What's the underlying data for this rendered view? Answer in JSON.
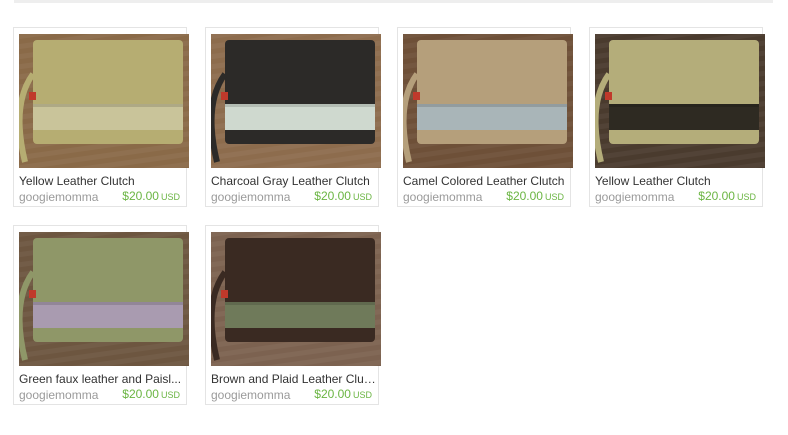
{
  "listings": [
    {
      "title": "Yellow Leather Clutch",
      "shop": "googiemomma",
      "price": "$20.00",
      "currency": "USD",
      "image_icon": "clutch-photo-icon",
      "clutch_color": "#b6ad72",
      "band_color": "#c9c49a",
      "bg_color": "#8a6a48"
    },
    {
      "title": "Charcoal Gray Leather Clutch",
      "shop": "googiemomma",
      "price": "$20.00",
      "currency": "USD",
      "image_icon": "clutch-photo-icon",
      "clutch_color": "#2c2a28",
      "band_color": "#cfd9cf",
      "bg_color": "#8d6c4d"
    },
    {
      "title": "Camel Colored Leather Clutch",
      "shop": "googiemomma",
      "price": "$20.00",
      "currency": "USD",
      "image_icon": "clutch-photo-icon",
      "clutch_color": "#b59f7b",
      "band_color": "#a9b5b8",
      "bg_color": "#6e5038"
    },
    {
      "title": "Yellow Leather Clutch",
      "shop": "googiemomma",
      "price": "$20.00",
      "currency": "USD",
      "image_icon": "clutch-photo-icon",
      "clutch_color": "#b4ad7a",
      "band_color": "#2e2a22",
      "bg_color": "#4a3b2e"
    },
    {
      "title": "Green faux leather and Paisl...",
      "shop": "googiemomma",
      "price": "$20.00",
      "currency": "USD",
      "image_icon": "clutch-photo-icon",
      "clutch_color": "#8f9768",
      "band_color": "#a99bb0",
      "bg_color": "#6d5640"
    },
    {
      "title": "Brown and Plaid Leather Clutch",
      "shop": "googiemomma",
      "price": "$20.00",
      "currency": "USD",
      "image_icon": "clutch-photo-icon",
      "clutch_color": "#3a2a22",
      "band_color": "#6f7a5a",
      "bg_color": "#7c6250"
    }
  ]
}
